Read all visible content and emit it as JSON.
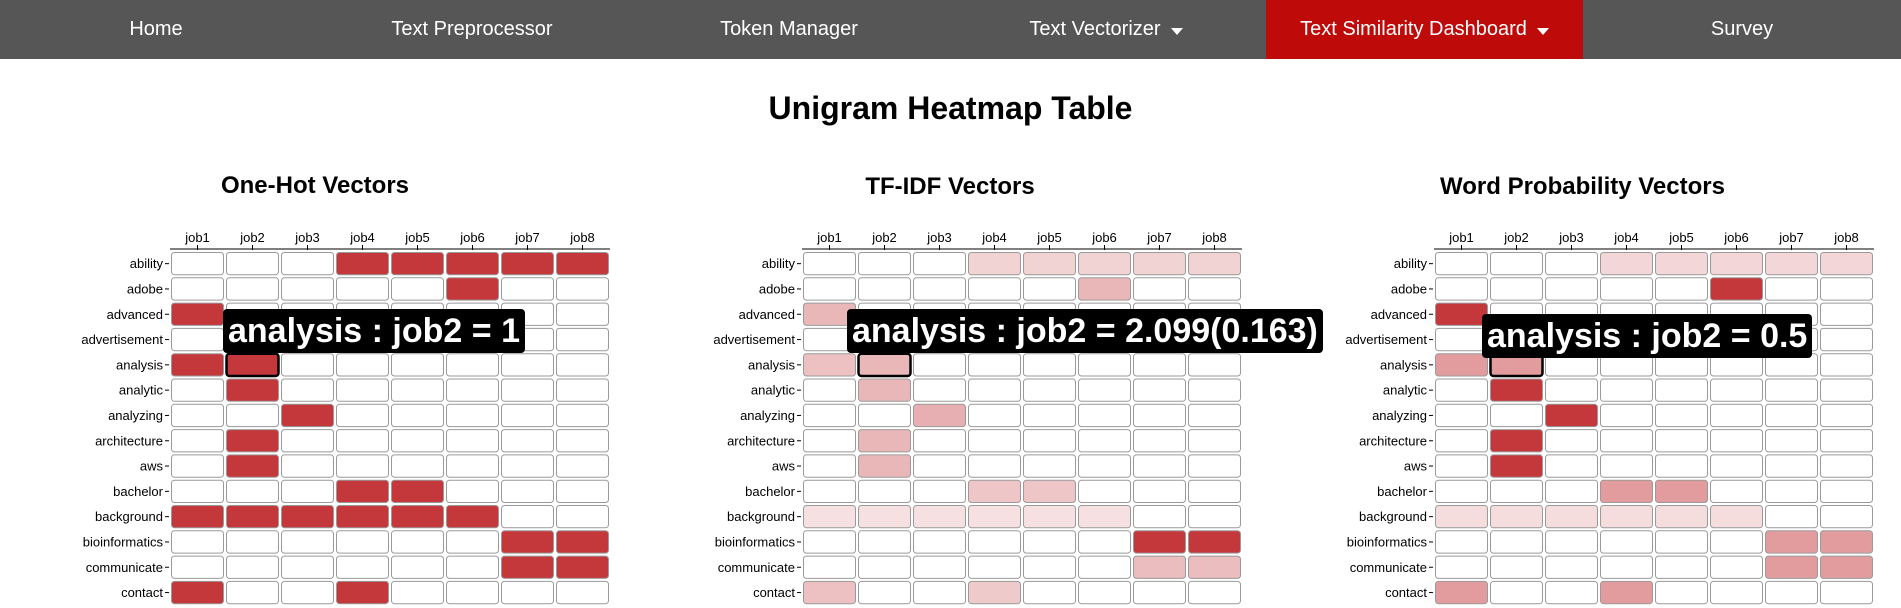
{
  "nav": {
    "items": [
      {
        "label": "Home"
      },
      {
        "label": "Text Preprocessor"
      },
      {
        "label": "Token Manager"
      },
      {
        "label": "Text Vectorizer"
      },
      {
        "label": "Text Similarity Dashboard"
      },
      {
        "label": "Survey"
      }
    ]
  },
  "page": {
    "title": "Unigram Heatmap Table"
  },
  "columns": [
    "job1",
    "job2",
    "job3",
    "job4",
    "job5",
    "job6",
    "job7",
    "job8"
  ],
  "rows": [
    "ability",
    "adobe",
    "advanced",
    "advertisement",
    "analysis",
    "analytic",
    "analyzing",
    "architecture",
    "aws",
    "bachelor",
    "background",
    "bioinformatics",
    "communicate",
    "contact"
  ],
  "colors": {
    "nav_bg": "#565656",
    "active_bg": "#bf0a0a",
    "cell_max": "#c4383c"
  },
  "panels": [
    {
      "title": "One-Hot Vectors",
      "tooltip": "analysis : job2 = 1",
      "chart_data": {
        "type": "heatmap",
        "x": [
          "job1",
          "job2",
          "job3",
          "job4",
          "job5",
          "job6",
          "job7",
          "job8"
        ],
        "y": [
          "ability",
          "adobe",
          "advanced",
          "advertisement",
          "analysis",
          "analytic",
          "analyzing",
          "architecture",
          "aws",
          "bachelor",
          "background",
          "bioinformatics",
          "communicate",
          "contact"
        ],
        "values": [
          [
            0,
            0,
            0,
            1,
            1,
            1,
            1,
            1
          ],
          [
            0,
            0,
            0,
            0,
            0,
            1,
            0,
            0
          ],
          [
            1,
            0,
            0,
            0,
            0,
            0,
            0,
            0
          ],
          [
            0,
            0,
            0,
            0,
            0,
            0,
            0,
            0
          ],
          [
            1,
            1,
            0,
            0,
            0,
            0,
            0,
            0
          ],
          [
            0,
            1,
            0,
            0,
            0,
            0,
            0,
            0
          ],
          [
            0,
            0,
            1,
            0,
            0,
            0,
            0,
            0
          ],
          [
            0,
            1,
            0,
            0,
            0,
            0,
            0,
            0
          ],
          [
            0,
            1,
            0,
            0,
            0,
            0,
            0,
            0
          ],
          [
            0,
            0,
            0,
            1,
            1,
            0,
            0,
            0
          ],
          [
            1,
            1,
            1,
            1,
            1,
            1,
            0,
            0
          ],
          [
            0,
            0,
            0,
            0,
            0,
            0,
            1,
            1
          ],
          [
            0,
            0,
            0,
            0,
            0,
            0,
            1,
            1
          ],
          [
            1,
            0,
            0,
            1,
            0,
            0,
            0,
            0
          ]
        ],
        "highlight": {
          "row": "analysis",
          "col": "job2"
        }
      }
    },
    {
      "title": "TF-IDF Vectors",
      "tooltip": "analysis : job2 = 2.099(0.163)",
      "chart_data": {
        "type": "heatmap",
        "x": [
          "job1",
          "job2",
          "job3",
          "job4",
          "job5",
          "job6",
          "job7",
          "job8"
        ],
        "y": [
          "ability",
          "adobe",
          "advanced",
          "advertisement",
          "analysis",
          "analytic",
          "analyzing",
          "architecture",
          "aws",
          "bachelor",
          "background",
          "bioinformatics",
          "communicate",
          "contact"
        ],
        "values": [
          [
            0,
            0,
            0,
            0.1,
            0.1,
            0.1,
            0.1,
            0.1
          ],
          [
            0,
            0,
            0,
            0,
            0,
            0.163,
            0,
            0
          ],
          [
            0.163,
            0,
            0,
            0,
            0,
            0,
            0,
            0
          ],
          [
            0,
            0,
            0,
            0,
            0,
            0,
            0,
            0
          ],
          [
            0.14,
            0.163,
            0,
            0,
            0,
            0,
            0,
            0
          ],
          [
            0,
            0.163,
            0,
            0,
            0,
            0,
            0,
            0
          ],
          [
            0,
            0,
            0.18,
            0,
            0,
            0,
            0,
            0
          ],
          [
            0,
            0.163,
            0,
            0,
            0,
            0,
            0,
            0
          ],
          [
            0,
            0.163,
            0,
            0,
            0,
            0,
            0,
            0
          ],
          [
            0,
            0,
            0,
            0.13,
            0.13,
            0,
            0,
            0
          ],
          [
            0.07,
            0.07,
            0.07,
            0.07,
            0.07,
            0.07,
            0,
            0
          ],
          [
            0,
            0,
            0,
            0,
            0,
            0,
            0.45,
            0.45
          ],
          [
            0,
            0,
            0,
            0,
            0,
            0,
            0.15,
            0.15
          ],
          [
            0.14,
            0,
            0,
            0.12,
            0,
            0,
            0,
            0
          ]
        ],
        "highlight": {
          "row": "analysis",
          "col": "job2"
        }
      }
    },
    {
      "title": "Word Probability Vectors",
      "tooltip": "analysis : job2 = 0.5",
      "chart_data": {
        "type": "heatmap",
        "x": [
          "job1",
          "job2",
          "job3",
          "job4",
          "job5",
          "job6",
          "job7",
          "job8"
        ],
        "y": [
          "ability",
          "adobe",
          "advanced",
          "advertisement",
          "analysis",
          "analytic",
          "analyzing",
          "architecture",
          "aws",
          "bachelor",
          "background",
          "bioinformatics",
          "communicate",
          "contact"
        ],
        "values": [
          [
            0,
            0,
            0,
            0.2,
            0.2,
            0.2,
            0.2,
            0.2
          ],
          [
            0,
            0,
            0,
            0,
            0,
            1,
            0,
            0
          ],
          [
            1,
            0,
            0,
            0,
            0,
            0,
            0,
            0
          ],
          [
            0,
            0,
            0,
            0,
            0,
            0,
            0,
            0
          ],
          [
            0.5,
            0.5,
            0,
            0,
            0,
            0,
            0,
            0
          ],
          [
            0,
            1,
            0,
            0,
            0,
            0,
            0,
            0
          ],
          [
            0,
            0,
            1,
            0,
            0,
            0,
            0,
            0
          ],
          [
            0,
            1,
            0,
            0,
            0,
            0,
            0,
            0
          ],
          [
            0,
            1,
            0,
            0,
            0,
            0,
            0,
            0
          ],
          [
            0,
            0,
            0,
            0.5,
            0.5,
            0,
            0,
            0
          ],
          [
            0.17,
            0.17,
            0.17,
            0.17,
            0.17,
            0.17,
            0,
            0
          ],
          [
            0,
            0,
            0,
            0,
            0,
            0,
            0.5,
            0.5
          ],
          [
            0,
            0,
            0,
            0,
            0,
            0,
            0.5,
            0.5
          ],
          [
            0.5,
            0,
            0,
            0.5,
            0,
            0,
            0,
            0
          ]
        ],
        "highlight": {
          "row": "analysis",
          "col": "job2"
        }
      }
    }
  ]
}
